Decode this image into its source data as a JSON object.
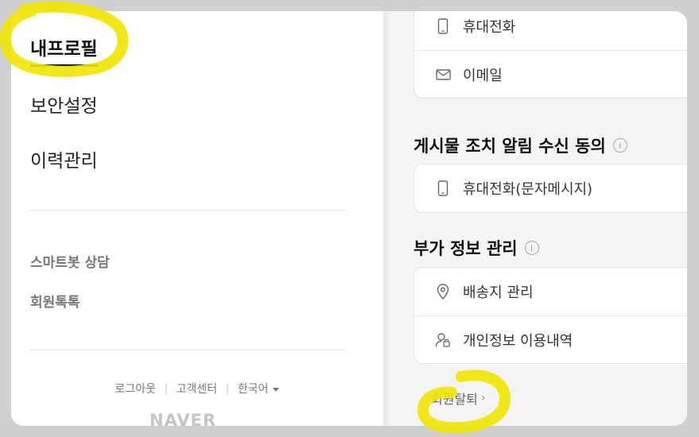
{
  "sidebar": {
    "profile_label": "내프로필",
    "security_label": "보안설정",
    "history_label": "이력관리",
    "smartbot_label": "스마트봇 상담",
    "talk_label": "회원톡톡"
  },
  "footer": {
    "logout": "로그아웃",
    "support": "고객센터",
    "language": "한국어",
    "separator": "|"
  },
  "logo": "NAVER",
  "contact_card": {
    "phone": "휴대전화",
    "email": "이메일"
  },
  "post_notice": {
    "title": "게시물 조치 알림 수신 동의",
    "phone_sms": "휴대전화(문자메시지)"
  },
  "extra_info": {
    "title": "부가 정보 관리",
    "shipping": "배송지 관리",
    "privacy_usage": "개인정보 이용내역"
  },
  "withdraw_label": "회원탈퇴",
  "info_glyph": "i",
  "chevron_glyph": "›",
  "colors": {
    "highlighter": "#f1e400",
    "panel_bg": "#f4f4f4",
    "page_bg": "#cfcfcf"
  }
}
